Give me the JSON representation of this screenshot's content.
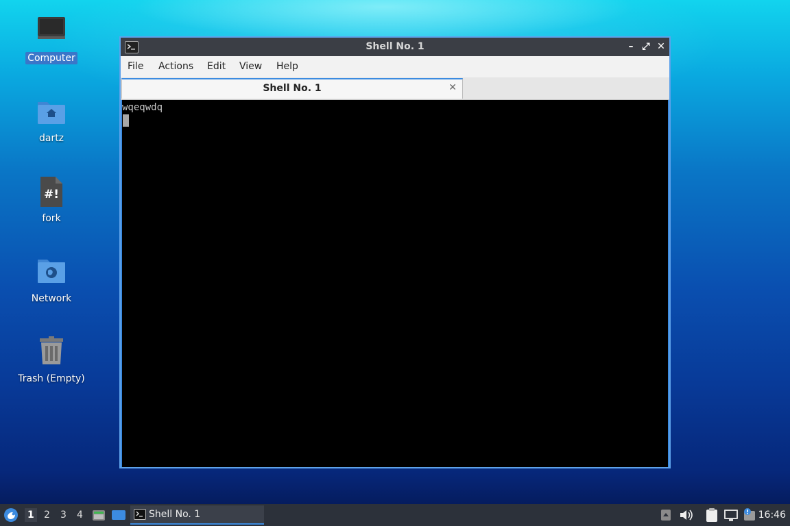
{
  "desktop": {
    "icons": [
      {
        "label": "Computer",
        "icon": "computer-icon"
      },
      {
        "label": "dartz",
        "icon": "home-folder-icon"
      },
      {
        "label": "fork",
        "icon": "script-file-icon"
      },
      {
        "label": "Network",
        "icon": "network-folder-icon"
      },
      {
        "label": "Trash (Empty)",
        "icon": "trash-icon"
      }
    ],
    "script_glyph": "#!"
  },
  "window": {
    "title": "Shell No. 1",
    "controls": {
      "minimize": "–",
      "maximize": "⤢",
      "close": "✕"
    },
    "menu": [
      "File",
      "Actions",
      "Edit",
      "View",
      "Help"
    ],
    "tab": {
      "label": "Shell No. 1",
      "close": "✕"
    },
    "terminal": {
      "lines": [
        "wqeqwdq"
      ]
    }
  },
  "taskbar": {
    "workspaces": [
      "1",
      "2",
      "3",
      "4"
    ],
    "active_workspace": "1",
    "task": {
      "label": "Shell No. 1"
    },
    "clock": "16:46"
  },
  "colors": {
    "accent": "#3c8be0",
    "titlebar": "#3b3e45",
    "taskbar": "#2c313a",
    "terminal_bg": "#000000"
  }
}
